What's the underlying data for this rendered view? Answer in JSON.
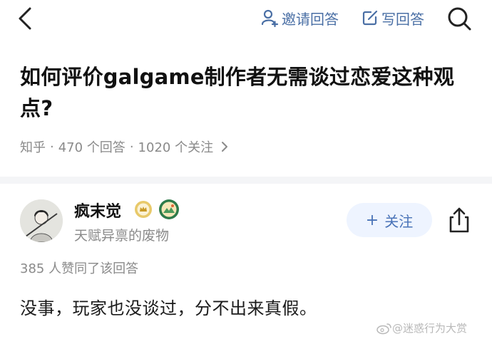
{
  "header": {
    "invite_label": "邀请回答",
    "write_label": "写回答",
    "accent_color": "#4a6fa5"
  },
  "question": {
    "title": "如何评价galgame制作者无需谈过恋爱这种观点?",
    "source": "知乎",
    "answers_count": "470 个回答",
    "followers_count": "1020 个关注"
  },
  "answer": {
    "author_name": "疯末觉",
    "author_bio": "天赋异禀的废物",
    "follow_label": "关注",
    "votes_text": "385 人赞同了该回答",
    "content": "没事，玩家也没谈过，分不出来真假。"
  },
  "watermark": {
    "text": "@迷惑行为大赏"
  },
  "icons": [
    "back-arrow-icon",
    "invite-user-icon",
    "edit-icon",
    "search-icon",
    "chevron-right-icon",
    "plus-icon",
    "share-icon",
    "level-badge-icon",
    "achievement-badge-icon",
    "weibo-icon"
  ]
}
